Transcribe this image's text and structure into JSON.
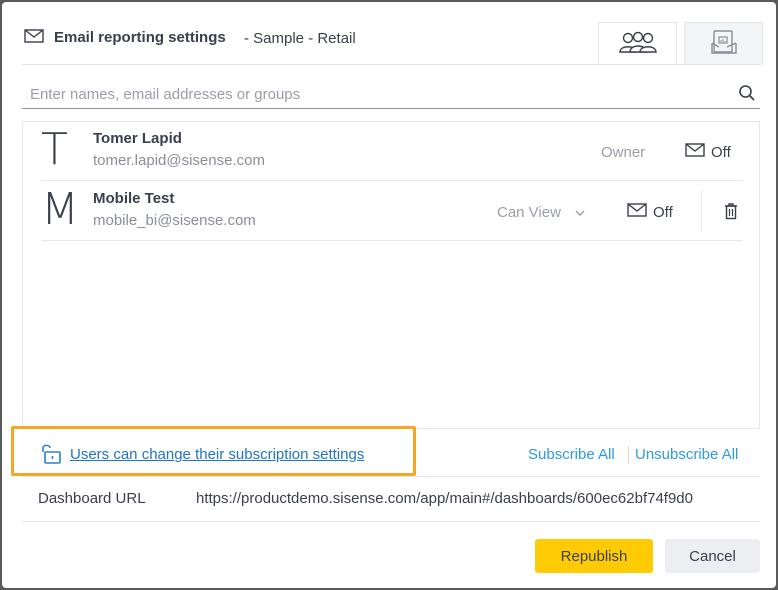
{
  "header": {
    "title": "Email reporting settings",
    "subtitle": "- Sample - Retail",
    "tabs": [
      {
        "icon": "users-group-icon",
        "active": true
      },
      {
        "icon": "report-document-icon",
        "active": false
      }
    ]
  },
  "search": {
    "placeholder": "Enter names, email addresses or groups",
    "value": ""
  },
  "users": [
    {
      "initial": "T",
      "name": "Tomer Lapid",
      "email": "tomer.lapid@sisense.com",
      "role": "Owner",
      "email_status": "Off"
    },
    {
      "initial": "M",
      "name": "Mobile Test",
      "email": "mobile_bi@sisense.com",
      "role": "Can View",
      "email_status": "Off"
    }
  ],
  "subscription": {
    "link_text": "Users can change their subscription settings",
    "subscribe_all": "Subscribe All",
    "unsubscribe_all": "Unsubscribe All"
  },
  "dashboard_url": {
    "label": "Dashboard URL",
    "value": "https://productdemo.sisense.com/app/main#/dashboards/600ec62bf74f9d0"
  },
  "buttons": {
    "republish": "Republish",
    "cancel": "Cancel"
  },
  "colors": {
    "accent_yellow": "#ffcb05",
    "link_blue": "#1f76c8",
    "highlight_orange": "#f5a623"
  }
}
